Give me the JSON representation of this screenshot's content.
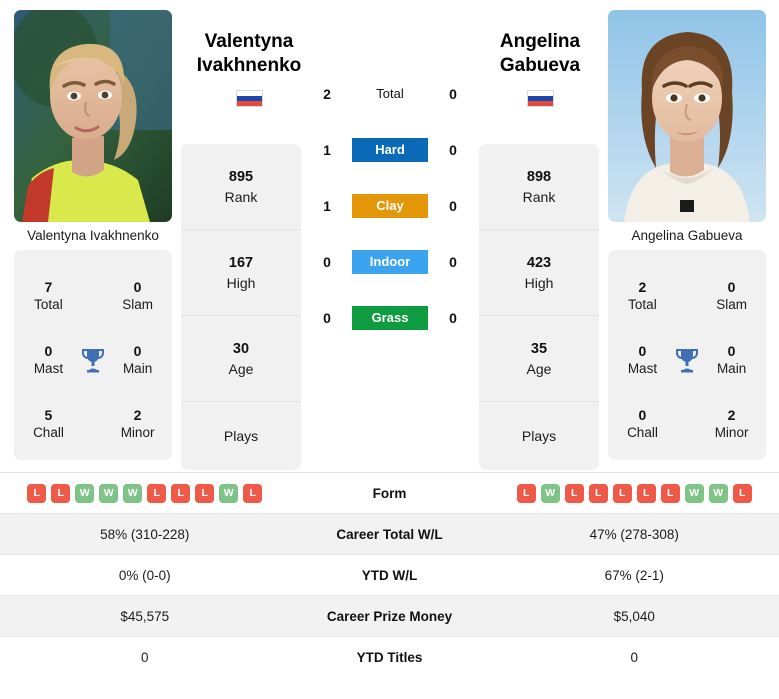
{
  "players": {
    "left": {
      "first_name": "Valentyna",
      "last_name": "Ivakhnenko",
      "full_name": "Valentyna Ivakhnenko",
      "country": "Russia",
      "flag_icon": "russia-flag",
      "rank": "895",
      "rank_label": "Rank",
      "high": "167",
      "high_label": "High",
      "age": "30",
      "age_label": "Age",
      "plays_label": "Plays",
      "plays_value": "",
      "titles": {
        "total": "7",
        "total_label": "Total",
        "slam": "0",
        "slam_label": "Slam",
        "mast": "0",
        "mast_label": "Mast",
        "main": "0",
        "main_label": "Main",
        "chall": "5",
        "chall_label": "Chall",
        "minor": "2",
        "minor_label": "Minor"
      },
      "form": [
        "L",
        "L",
        "W",
        "W",
        "W",
        "L",
        "L",
        "L",
        "W",
        "L"
      ],
      "career_total_wl": "58% (310-228)",
      "ytd_wl": "0% (0-0)",
      "career_prize_money": "$45,575",
      "ytd_titles": "0"
    },
    "right": {
      "first_name": "Angelina",
      "last_name": "Gabueva",
      "full_name": "Angelina Gabueva",
      "country": "Russia",
      "flag_icon": "russia-flag",
      "rank": "898",
      "rank_label": "Rank",
      "high": "423",
      "high_label": "High",
      "age": "35",
      "age_label": "Age",
      "plays_label": "Plays",
      "plays_value": "",
      "titles": {
        "total": "2",
        "total_label": "Total",
        "slam": "0",
        "slam_label": "Slam",
        "mast": "0",
        "mast_label": "Mast",
        "main": "0",
        "main_label": "Main",
        "chall": "0",
        "chall_label": "Chall",
        "minor": "2",
        "minor_label": "Minor"
      },
      "form": [
        "L",
        "W",
        "L",
        "L",
        "L",
        "L",
        "L",
        "W",
        "W",
        "L"
      ],
      "career_total_wl": "47% (278-308)",
      "ytd_wl": "67% (2-1)",
      "career_prize_money": "$5,040",
      "ytd_titles": "0"
    }
  },
  "head_to_head": [
    {
      "label": "Total",
      "left": "2",
      "right": "0",
      "color": ""
    },
    {
      "label": "Hard",
      "left": "1",
      "right": "0",
      "color": "#0b6ab8"
    },
    {
      "label": "Clay",
      "left": "1",
      "right": "0",
      "color": "#e39608"
    },
    {
      "label": "Indoor",
      "left": "0",
      "right": "0",
      "color": "#3ba3f0"
    },
    {
      "label": "Grass",
      "left": "0",
      "right": "0",
      "color": "#0f9b40"
    }
  ],
  "comparison_rows": [
    {
      "label": "Form",
      "type": "form"
    },
    {
      "label": "Career Total W/L",
      "type": "text",
      "left": "58% (310-228)",
      "right": "47% (278-308)"
    },
    {
      "label": "YTD W/L",
      "type": "text",
      "left": "0% (0-0)",
      "right": "67% (2-1)"
    },
    {
      "label": "Career Prize Money",
      "type": "text",
      "left": "$45,575",
      "right": "$5,040"
    },
    {
      "label": "YTD Titles",
      "type": "text",
      "left": "0",
      "right": "0"
    }
  ],
  "colors": {
    "hard": "#0b6ab8",
    "clay": "#e39608",
    "indoor": "#3ba3f0",
    "grass": "#0f9b40",
    "win_badge": "#80c387",
    "loss_badge": "#ef5a48",
    "panel_bg": "#f1f1f1",
    "row_alt_bg": "#f2f2f2",
    "trophy": "#3f6fb5"
  }
}
